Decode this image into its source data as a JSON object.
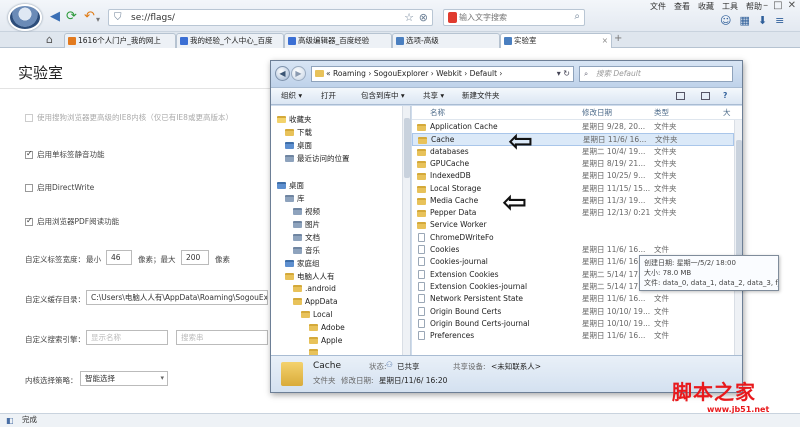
{
  "browser": {
    "url": "se://flags/",
    "search_placeholder": "输入文字搜索",
    "menu": [
      "文件",
      "查看",
      "收藏",
      "工具",
      "帮助"
    ],
    "tabs": [
      {
        "label": "1616个人门户_我的网上",
        "color": "#e27a1f"
      },
      {
        "label": "我的经验_个人中心_百度",
        "color": "#3b6fd4"
      },
      {
        "label": "高级编辑器_百度经验",
        "color": "#3b6fd4"
      },
      {
        "label": "选项-高级",
        "color": "#4a7fc0"
      },
      {
        "label": "实验室",
        "color": "#4a7fc0"
      }
    ],
    "status": "完成"
  },
  "flags_page": {
    "title": "实验室",
    "rows": [
      {
        "label": "使用搜狗浏览器更高级的IE8内核（仅已有IE8或更高版本）",
        "checked": false,
        "dim": true
      },
      {
        "label": "启用单标签静音功能",
        "checked": true,
        "dim": false
      },
      {
        "label": "启用DirectWrite",
        "checked": false,
        "dim": false
      },
      {
        "label": "启用浏览器PDF阅读功能",
        "checked": true,
        "dim": false
      }
    ],
    "tab_width": {
      "label": "自定义标签宽度：",
      "min_label": "最小",
      "min_value": "46",
      "unit1": "像素；最大",
      "max_value": "200",
      "unit2": "像素"
    },
    "cache_dir": {
      "label": "自定义缓存目录：",
      "value": "C:\\Users\\电脑人人有\\AppData\\Roaming\\SogouEx"
    },
    "search_engine": {
      "label": "自定义搜索引擎：",
      "placeholder1": "显示名称",
      "placeholder2": "搜索串"
    },
    "kernel": {
      "label": "内核选择策略：",
      "value": "智能选择"
    }
  },
  "explorer": {
    "path": "« Roaming › SogouExplorer › Webkit › Default ›",
    "search_placeholder": "搜索 Default",
    "commands": [
      "组织 ▾",
      "打开",
      "包含到库中 ▾",
      "共享 ▾",
      "新建文件夹"
    ],
    "nav": [
      {
        "label": "收藏夹",
        "icon": "star"
      },
      {
        "label": "下载",
        "icon": "folder"
      },
      {
        "label": "桌面",
        "icon": "blue"
      },
      {
        "label": "最近访问的位置",
        "icon": "gray"
      },
      {
        "label": "桌面",
        "icon": "blue"
      },
      {
        "label": "库",
        "icon": "gray"
      },
      {
        "label": "视频",
        "icon": "gray"
      },
      {
        "label": "图片",
        "icon": "gray"
      },
      {
        "label": "文档",
        "icon": "gray"
      },
      {
        "label": "音乐",
        "icon": "gray"
      },
      {
        "label": "家庭组",
        "icon": "blue"
      },
      {
        "label": "电脑人人有",
        "icon": "folder"
      },
      {
        "label": ".android",
        "icon": "folder"
      },
      {
        "label": "AppData",
        "icon": "folder"
      },
      {
        "label": "Local",
        "icon": "folder"
      },
      {
        "label": "Adobe",
        "icon": "folder"
      },
      {
        "label": "Apple",
        "icon": "folder"
      },
      {
        "label": "",
        "icon": "folder"
      }
    ],
    "columns": [
      "名称",
      "修改日期",
      "类型",
      "大"
    ],
    "files": [
      {
        "name": "Application Cache",
        "date": "星期日 9/28, 20...",
        "type": "文件夹",
        "kind": "folder"
      },
      {
        "name": "Cache",
        "date": "星期日 11/6/ 16...",
        "type": "文件夹",
        "kind": "folder",
        "selected": true
      },
      {
        "name": "databases",
        "date": "星期二 10/4/ 19...",
        "type": "文件夹",
        "kind": "folder"
      },
      {
        "name": "GPUCache",
        "date": "星期日 8/19/ 21...",
        "type": "文件夹",
        "kind": "folder"
      },
      {
        "name": "IndexedDB",
        "date": "星期日 10/25/ 9...",
        "type": "文件夹",
        "kind": "folder"
      },
      {
        "name": "Local Storage",
        "date": "星期日 11/15/ 15...",
        "type": "文件夹",
        "kind": "folder"
      },
      {
        "name": "Media Cache",
        "date": "星期日 11/3/ 19...",
        "type": "文件夹",
        "kind": "folder"
      },
      {
        "name": "Pepper Data",
        "date": "星期日 12/13/ 0:21",
        "type": "文件夹",
        "kind": "folder"
      },
      {
        "name": "Service Worker",
        "date": "",
        "type": "",
        "kind": "folder"
      },
      {
        "name": "ChromeDWriteFo",
        "date": "",
        "type": "",
        "kind": "file"
      },
      {
        "name": "Cookies",
        "date": "星期日 11/6/ 16...",
        "type": "文件",
        "kind": "file"
      },
      {
        "name": "Cookies-journal",
        "date": "星期日 11/6/ 16...",
        "type": "文件",
        "kind": "file"
      },
      {
        "name": "Extension Cookies",
        "date": "星期二 5/14/ 17...",
        "type": "文件",
        "kind": "file"
      },
      {
        "name": "Extension Cookies-journal",
        "date": "星期二 5/14/ 17...",
        "type": "文件",
        "kind": "file"
      },
      {
        "name": "Network Persistent State",
        "date": "星期日 11/6/ 16...",
        "type": "文件",
        "kind": "file"
      },
      {
        "name": "Origin Bound Certs",
        "date": "星期日 10/10/ 19...",
        "type": "文件",
        "kind": "file"
      },
      {
        "name": "Origin Bound Certs-journal",
        "date": "星期日 10/10/ 19...",
        "type": "文件",
        "kind": "file"
      },
      {
        "name": "Preferences",
        "date": "星期日 11/6/ 16...",
        "type": "文件",
        "kind": "file"
      }
    ],
    "tooltip": {
      "line1": "创建日期: 星期一/5/2/ 18:00",
      "line2": "大小: 78.0 MB",
      "line3": "文件: data_0, data_1, data_2, data_3, f_00000a, f_00000b, ..."
    },
    "details": {
      "name": "Cache",
      "state_label": "状态:",
      "state_value": "已共享",
      "type": "文件夹",
      "modified_label": "修改日期:",
      "modified_value": "星期日/11/6/ 16:20",
      "share_label": "共享设备:",
      "share_value": "<未知联系人>"
    }
  },
  "watermark": {
    "text": "脚本之家",
    "url": "www.jb51.net"
  }
}
